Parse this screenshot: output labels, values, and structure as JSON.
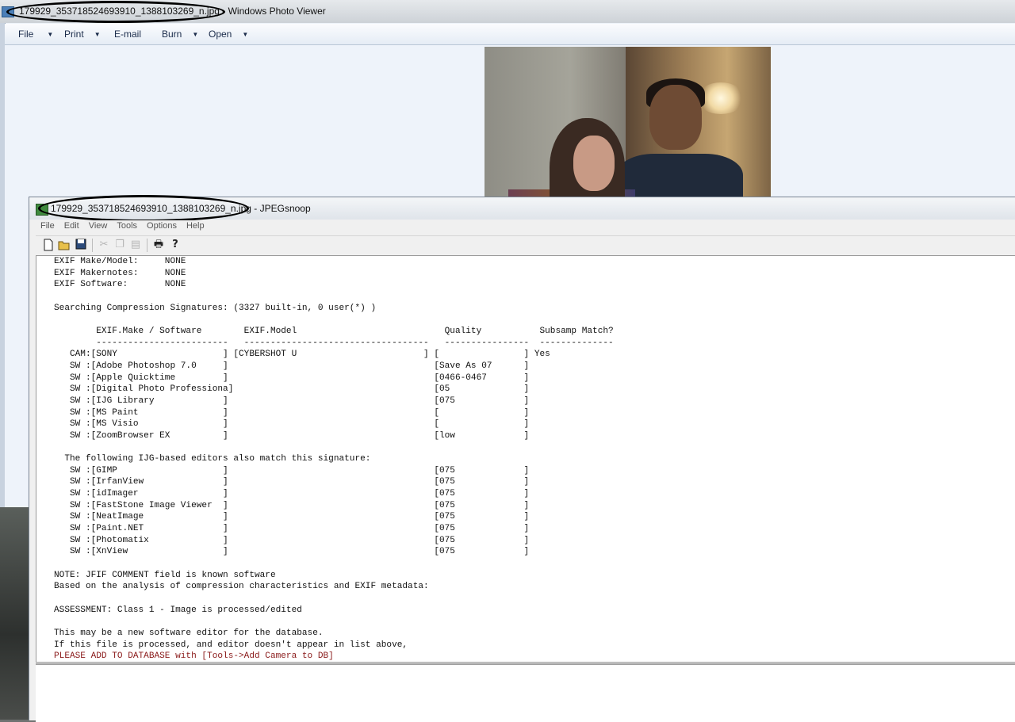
{
  "photo_viewer": {
    "title": "179929_353718524693910_1388103269_n.jpg - Windows Photo Viewer",
    "menu": [
      {
        "label": "File",
        "has_arrow": true
      },
      {
        "label": "Print",
        "has_arrow": true
      },
      {
        "label": "E-mail",
        "has_arrow": false
      },
      {
        "label": "Burn",
        "has_arrow": true
      },
      {
        "label": "Open",
        "has_arrow": true
      }
    ]
  },
  "jpegsnoop": {
    "title": "179929_353718524693910_1388103269_n.jpg - JPEGsnoop",
    "menu": [
      "File",
      "Edit",
      "View",
      "Tools",
      "Options",
      "Help"
    ],
    "toolbar_icons": [
      "new-file-icon",
      "open-folder-icon",
      "save-icon",
      "cut-icon",
      "copy-icon",
      "paste-icon",
      "print-icon",
      "help-icon"
    ],
    "report_lines": [
      "EXIF Make/Model:     NONE",
      "EXIF Makernotes:     NONE",
      "EXIF Software:       NONE",
      "",
      "Searching Compression Signatures: (3327 built-in, 0 user(*) )",
      "",
      "        EXIF.Make / Software        EXIF.Model                            Quality           Subsamp Match?",
      "        -------------------------   -----------------------------------   ----------------  --------------",
      "   CAM:[SONY                    ] [CYBERSHOT U                        ] [                ] Yes",
      "   SW :[Adobe Photoshop 7.0     ]                                       [Save As 07      ]",
      "   SW :[Apple Quicktime         ]                                       [0466-0467       ]",
      "   SW :[Digital Photo Professiona]                                      [05              ]",
      "   SW :[IJG Library             ]                                       [075             ]",
      "   SW :[MS Paint                ]                                       [                ]",
      "   SW :[MS Visio                ]                                       [                ]",
      "   SW :[ZoomBrowser EX          ]                                       [low             ]",
      "",
      "  The following IJG-based editors also match this signature:",
      "   SW :[GIMP                    ]                                       [075             ]",
      "   SW :[IrfanView               ]                                       [075             ]",
      "   SW :[idImager                ]                                       [075             ]",
      "   SW :[FastStone Image Viewer  ]                                       [075             ]",
      "   SW :[NeatImage               ]                                       [075             ]",
      "   SW :[Paint.NET               ]                                       [075             ]",
      "   SW :[Photomatix              ]                                       [075             ]",
      "   SW :[XnView                  ]                                       [075             ]",
      "",
      "NOTE: JFIF COMMENT field is known software",
      "Based on the analysis of compression characteristics and EXIF metadata:",
      "",
      "ASSESSMENT: Class 1 - Image is processed/edited",
      "",
      "This may be a new software editor for the database.",
      "If this file is processed, and editor doesn't appear in list above,"
    ],
    "report_warning": "PLEASE ADD TO DATABASE with [Tools->Add Camera to DB]"
  }
}
